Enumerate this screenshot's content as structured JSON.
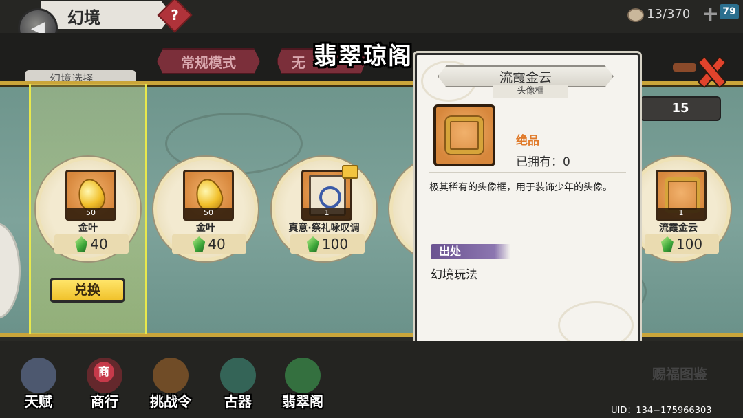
{
  "header": {
    "title": "幻境",
    "help_icon_text": "?",
    "stamina": "13/370",
    "plus": "+",
    "badge": "79"
  },
  "tabs": {
    "normal_mode": "常规模式",
    "second_mode_partial": "无"
  },
  "panel": {
    "title": "翡翠琼阁",
    "left_pill": "幻境选择",
    "count": "15"
  },
  "shop_items": [
    {
      "name": "金叶",
      "qty": "50",
      "price": "40",
      "icon": "gold-leaf-icon"
    },
    {
      "name": "金叶",
      "qty": "50",
      "price": "40",
      "icon": "gold-leaf-icon"
    },
    {
      "name": "真意·祭礼咏叹调",
      "qty": "1",
      "price": "100",
      "icon": "card-icon"
    },
    {
      "name": "流霞金云",
      "qty": "1",
      "price": "100",
      "icon": "frame-icon"
    }
  ],
  "exchange_label": "兑换",
  "tooltip": {
    "name": "流霞金云",
    "type": "头像框",
    "rarity": "绝品",
    "owned": "已拥有：0",
    "description": "极其稀有的头像框，用于装饰少年的头像。",
    "source_label": "出处",
    "source_value": "幻境玩法"
  },
  "bottom_nav": [
    {
      "label": "天赋",
      "icon": "talent-icon",
      "color": "#5b6a8a"
    },
    {
      "label": "商行",
      "icon": "shop-icon",
      "color": "#c0303e"
    },
    {
      "label": "挑战令",
      "icon": "challenge-icon",
      "color": "#8a5a2a"
    },
    {
      "label": "古器",
      "icon": "artifact-icon",
      "color": "#3a7a6a"
    },
    {
      "label": "翡翠阁",
      "icon": "jade-pavilion-icon",
      "color": "#3a8a4a"
    }
  ],
  "collection_label": "赐福图鉴",
  "uid": "UID：134−175966303",
  "colors": {
    "gold_border": "#caa53a",
    "teal_band": "#7ea39b",
    "rarity_orange": "#e07a2a",
    "source_purple": "#6a5290",
    "exchange_yellow": "#f0c12a"
  }
}
